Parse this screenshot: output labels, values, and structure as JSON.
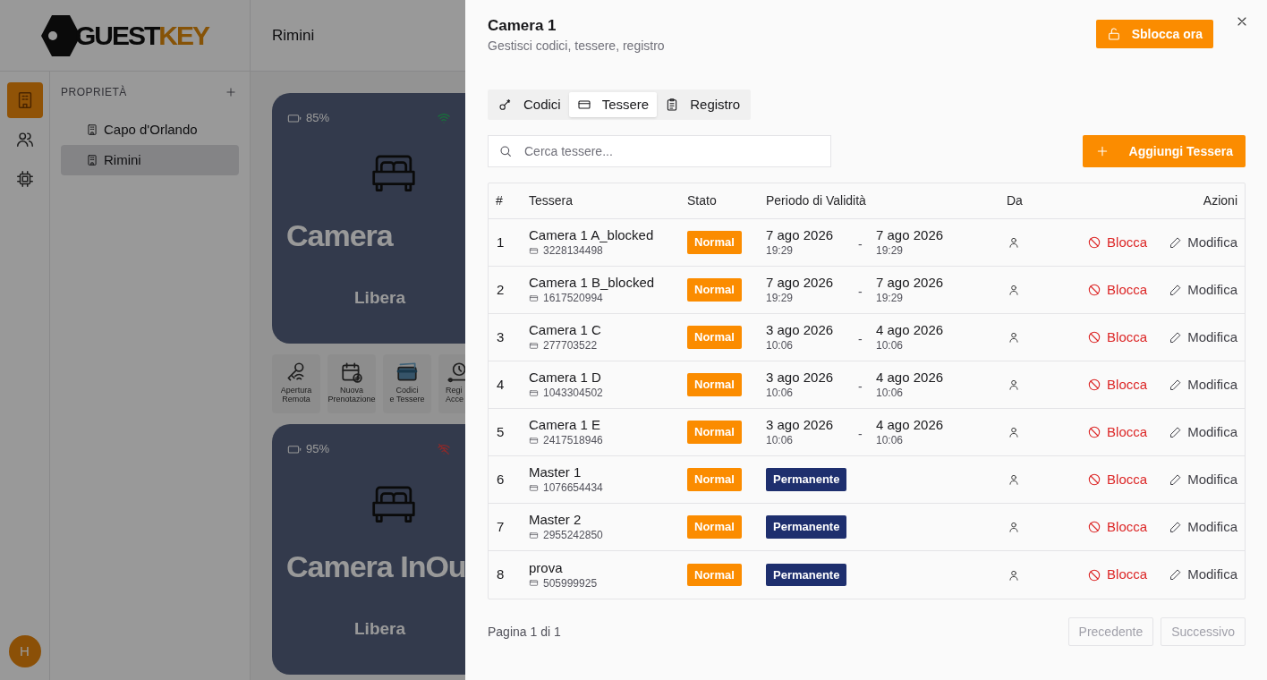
{
  "logo": {
    "part_1": "GUEST",
    "part_2": "KEY"
  },
  "header": {
    "title": "Rimini"
  },
  "rail": [
    {
      "kind": "building",
      "selected": true
    },
    {
      "kind": "users",
      "selected": false
    },
    {
      "kind": "chip",
      "selected": false
    }
  ],
  "avatar": "H",
  "properties": {
    "heading": "PROPRIETÀ",
    "items": [
      {
        "label": "Capo d'Orlando",
        "selected": false
      },
      {
        "label": "Rimini",
        "selected": true
      }
    ]
  },
  "rooms": [
    {
      "battery": "85%",
      "online": true,
      "name": "Camera",
      "status": "Libera"
    },
    {
      "battery": "95%",
      "online": false,
      "name": "Camera InOu",
      "status": "Libera"
    }
  ],
  "quick_actions": [
    {
      "kind": "remote",
      "label": "Apertura Remota"
    },
    {
      "kind": "booking",
      "label": "Nuova Prenotazione"
    },
    {
      "kind": "cards",
      "label": "Codici e Tessere"
    },
    {
      "kind": "log",
      "label": "Regi Acce"
    }
  ],
  "drawer": {
    "title": "Camera 1",
    "subtitle": "Gestisci codici, tessere, registro",
    "unlock_button": "Sblocca ora",
    "tabs": [
      {
        "kind": "key",
        "label": "Codici",
        "selected": false
      },
      {
        "kind": "card",
        "label": "Tessere",
        "selected": true
      },
      {
        "kind": "clipboard",
        "label": "Registro",
        "selected": false
      }
    ],
    "search": {
      "placeholder": "Cerca tessere..."
    },
    "add_button": "Aggiungi Tessera",
    "table": {
      "columns": [
        "#",
        "Tessera",
        "Stato",
        "Periodo di Validità",
        "Da",
        "Azioni"
      ],
      "rows": [
        {
          "index": "1",
          "name": "Camera 1 A_blocked",
          "card_number": "3228134498",
          "state": "Normal",
          "validity": {
            "kind": "range",
            "start_date": "7 ago 2026",
            "start_time": "19:29",
            "separator": "-",
            "end_date": "7 ago 2026",
            "end_time": "19:29"
          },
          "block": "Blocca",
          "edit": "Modifica"
        },
        {
          "index": "2",
          "name": "Camera 1 B_blocked",
          "card_number": "1617520994",
          "state": "Normal",
          "validity": {
            "kind": "range",
            "start_date": "7 ago 2026",
            "start_time": "19:29",
            "separator": "-",
            "end_date": "7 ago 2026",
            "end_time": "19:29"
          },
          "block": "Blocca",
          "edit": "Modifica"
        },
        {
          "index": "3",
          "name": "Camera 1 C",
          "card_number": "277703522",
          "state": "Normal",
          "validity": {
            "kind": "range",
            "start_date": "3 ago 2026",
            "start_time": "10:06",
            "separator": "-",
            "end_date": "4 ago 2026",
            "end_time": "10:06"
          },
          "block": "Blocca",
          "edit": "Modifica"
        },
        {
          "index": "4",
          "name": "Camera 1 D",
          "card_number": "1043304502",
          "state": "Normal",
          "validity": {
            "kind": "range",
            "start_date": "3 ago 2026",
            "start_time": "10:06",
            "separator": "-",
            "end_date": "4 ago 2026",
            "end_time": "10:06"
          },
          "block": "Blocca",
          "edit": "Modifica"
        },
        {
          "index": "5",
          "name": "Camera 1 E",
          "card_number": "2417518946",
          "state": "Normal",
          "validity": {
            "kind": "range",
            "start_date": "3 ago 2026",
            "start_time": "10:06",
            "separator": "-",
            "end_date": "4 ago 2026",
            "end_time": "10:06"
          },
          "block": "Blocca",
          "edit": "Modifica"
        },
        {
          "index": "6",
          "name": "Master 1",
          "card_number": "1076654434",
          "state": "Normal",
          "validity": {
            "kind": "permanent",
            "label": "Permanente"
          },
          "block": "Blocca",
          "edit": "Modifica"
        },
        {
          "index": "7",
          "name": "Master 2",
          "card_number": "2955242850",
          "state": "Normal",
          "validity": {
            "kind": "permanent",
            "label": "Permanente"
          },
          "block": "Blocca",
          "edit": "Modifica"
        },
        {
          "index": "8",
          "name": "prova",
          "card_number": "505999925",
          "state": "Normal",
          "validity": {
            "kind": "permanent",
            "label": "Permanente"
          },
          "block": "Blocca",
          "edit": "Modifica"
        }
      ]
    },
    "pagination": {
      "label": "Pagina 1 di 1",
      "previous": {
        "label": "Precedente",
        "disabled": true
      },
      "next": {
        "label": "Successivo",
        "disabled": true
      }
    }
  }
}
